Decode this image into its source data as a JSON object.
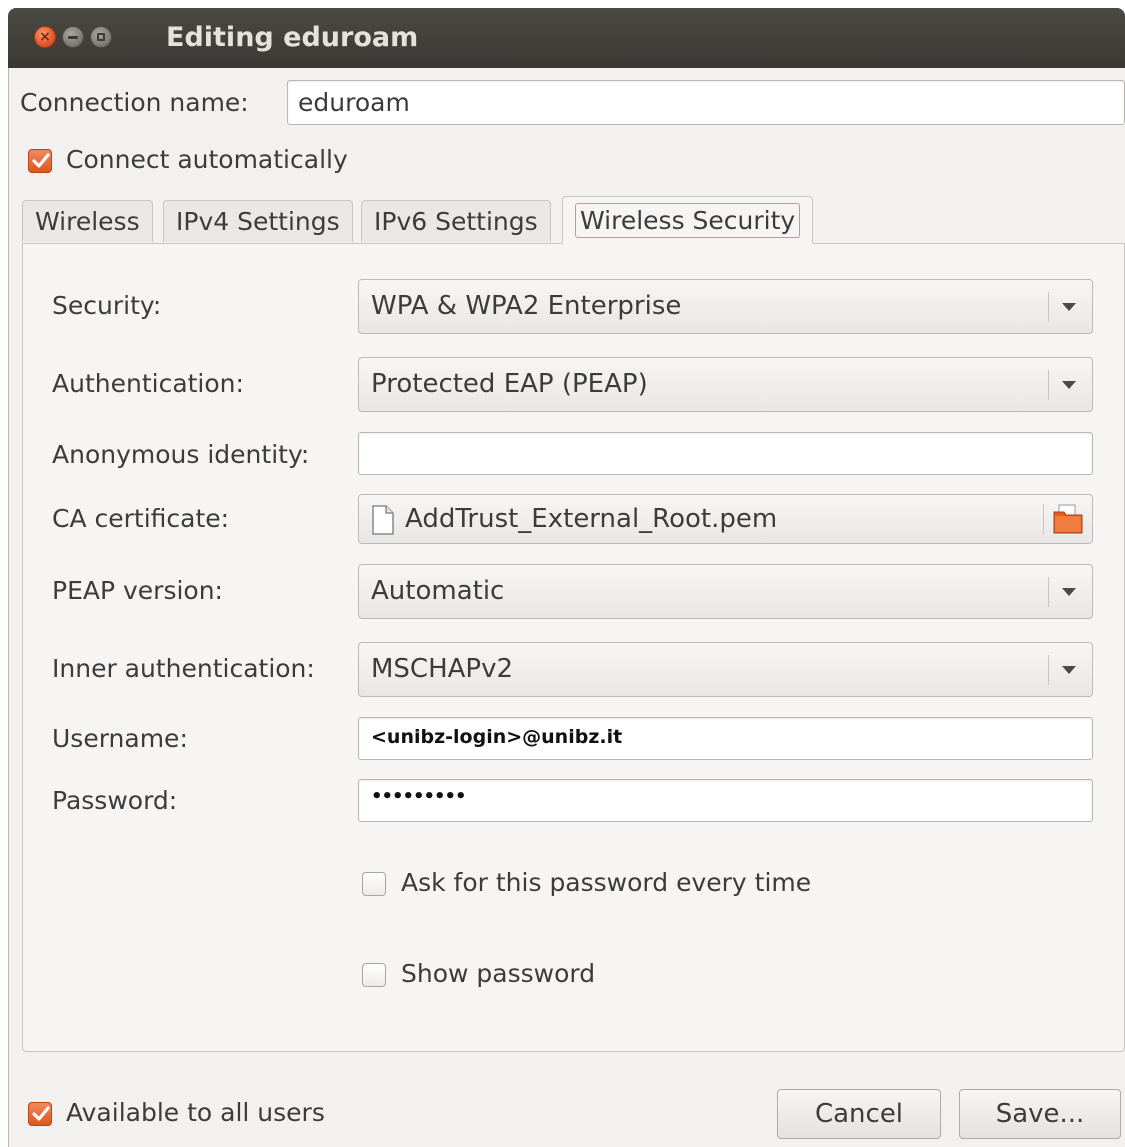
{
  "window": {
    "title": "Editing eduroam"
  },
  "connection": {
    "name_label": "Connection name:",
    "name_value": "eduroam",
    "connect_auto_label": "Connect automatically",
    "connect_auto_checked": true
  },
  "tabs": [
    {
      "label": "Wireless",
      "active": false
    },
    {
      "label": "IPv4 Settings",
      "active": false
    },
    {
      "label": "IPv6 Settings",
      "active": false
    },
    {
      "label": "Wireless Security",
      "active": true
    }
  ],
  "security": {
    "security_label": "Security:",
    "security_value": "WPA & WPA2 Enterprise",
    "auth_label": "Authentication:",
    "auth_value": "Protected EAP (PEAP)",
    "anon_label": "Anonymous identity:",
    "anon_value": "",
    "ca_label": "CA certificate:",
    "ca_value": "AddTrust_External_Root.pem",
    "peap_label": "PEAP version:",
    "peap_value": "Automatic",
    "inner_label": "Inner authentication:",
    "inner_value": "MSCHAPv2",
    "username_label": "Username:",
    "username_value": "<unibz-login>@unibz.it",
    "password_label": "Password:",
    "password_value": "•••••••••",
    "ask_label": "Ask for this password every time",
    "ask_checked": false,
    "show_label": "Show password",
    "show_checked": false
  },
  "footer": {
    "all_users_label": "Available to all users",
    "all_users_checked": true,
    "cancel_label": "Cancel",
    "save_label": "Save..."
  },
  "colors": {
    "accent": "#dd5520",
    "titlebar": "#3c3b37"
  },
  "icons": {
    "close": "close-icon",
    "minimize": "minimize-icon",
    "maximize": "maximize-icon",
    "certificate_file": "document-icon",
    "file_chooser": "folder-icon",
    "dropdown": "chevron-down-icon",
    "check": "checkmark-icon"
  }
}
